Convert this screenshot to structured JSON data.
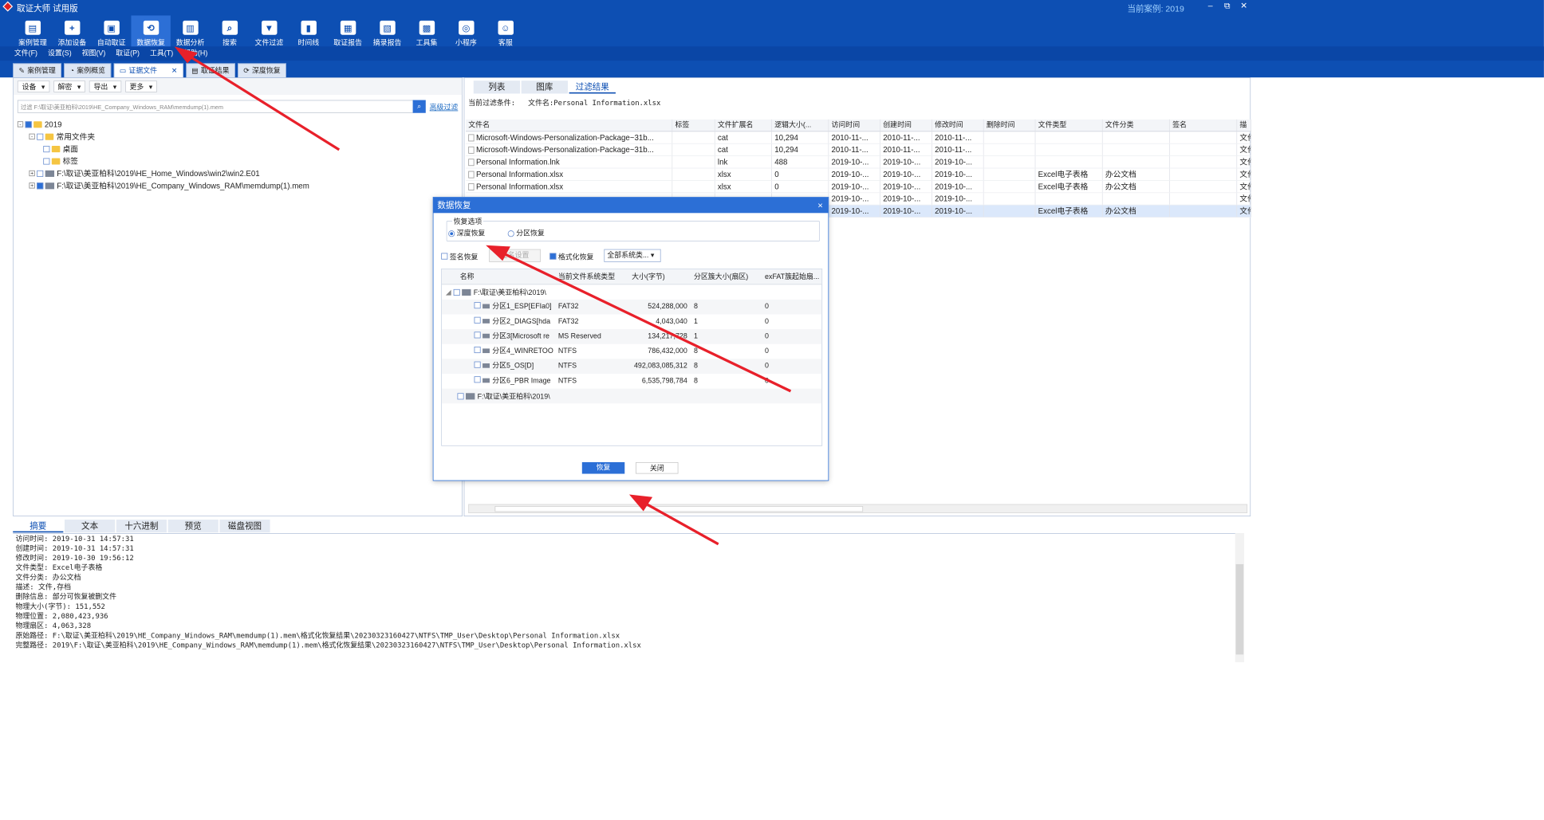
{
  "app": {
    "title": "取证大师 试用版",
    "current_case_label": "当前案例: 2019",
    "win_min": "–",
    "win_max": "⧉",
    "win_close": "✕"
  },
  "toolbar": [
    "案例管理",
    "添加设备",
    "自动取证",
    "数据恢复",
    "数据分析",
    "搜索",
    "文件过滤",
    "时间线",
    "取证报告",
    "摘录报告",
    "工具集",
    "小程序",
    "客服"
  ],
  "menu": [
    "文件(F)",
    "设置(S)",
    "视图(V)",
    "取证(P)",
    "工具(T)",
    "帮助(H)"
  ],
  "doc_tabs": [
    "案例管理",
    "案例概览",
    "证据文件",
    "取证结果",
    "深度恢复"
  ],
  "left": {
    "tools": [
      "设备",
      "解密",
      "导出",
      "更多"
    ],
    "filter_text": "过滤 F:\\取证\\美亚柏科\\2019\\HE_Company_Windows_RAM\\memdump(1).mem",
    "adv_filter": "高级过滤",
    "tree": [
      "2019",
      "常用文件夹",
      "桌面",
      "标签",
      "F:\\取证\\美亚柏科\\2019\\HE_Home_Windows\\win2\\win2.E01",
      "F:\\取证\\美亚柏科\\2019\\HE_Company_Windows_RAM\\memdump(1).mem"
    ]
  },
  "right": {
    "tabs": [
      "列表",
      "图库",
      "过滤结果"
    ],
    "cond_label": "当前过滤条件:",
    "cond_value": "文件名:Personal Information.xlsx",
    "columns": [
      "文件名",
      "标签",
      "文件扩展名",
      "逻辑大小(...",
      "访问时间",
      "创建时间",
      "修改时间",
      "删除时间",
      "文件类型",
      "文件分类",
      "签名",
      "描"
    ],
    "rows": [
      [
        "Microsoft-Windows-Personalization-Package~31b...",
        "",
        "cat",
        "10,294",
        "2010-11-...",
        "2010-11-...",
        "2010-11-...",
        "",
        "",
        "",
        "",
        "文件"
      ],
      [
        "Microsoft-Windows-Personalization-Package~31b...",
        "",
        "cat",
        "10,294",
        "2010-11-...",
        "2010-11-...",
        "2010-11-...",
        "",
        "",
        "",
        "",
        "文件"
      ],
      [
        "Personal Information.lnk",
        "",
        "lnk",
        "488",
        "2019-10-...",
        "2019-10-...",
        "2019-10-...",
        "",
        "",
        "",
        "",
        "文件"
      ],
      [
        "Personal Information.xlsx",
        "",
        "xlsx",
        "0",
        "2019-10-...",
        "2019-10-...",
        "2019-10-...",
        "",
        "Excel电子表格",
        "办公文档",
        "",
        "文件"
      ],
      [
        "Personal Information.xlsx",
        "",
        "xlsx",
        "0",
        "2019-10-...",
        "2019-10-...",
        "2019-10-...",
        "",
        "Excel电子表格",
        "办公文档",
        "",
        "文件"
      ],
      [
        "",
        "",
        "",
        "",
        "2019-10-...",
        "2019-10-...",
        "2019-10-...",
        "",
        "",
        "",
        "",
        "文件"
      ],
      [
        "",
        "",
        "",
        "",
        "2019-10-...",
        "2019-10-...",
        "2019-10-...",
        "",
        "Excel电子表格",
        "办公文档",
        "",
        "文件"
      ]
    ]
  },
  "bottom": {
    "tabs": [
      "摘要",
      "文本",
      "十六进制",
      "预览",
      "磁盘视图"
    ],
    "lines": [
      "访问时间: 2019-10-31 14:57:31",
      "创建时间: 2019-10-31 14:57:31",
      "修改时间: 2019-10-30 19:56:12",
      "文件类型: Excel电子表格",
      "文件分类: 办公文档",
      "描述: 文件,存档",
      "删除信息: 部分可恢复被删文件",
      "物理大小(字节): 151,552",
      "物理位置: 2,080,423,936",
      "物理扇区: 4,063,328",
      "原始路径: F:\\取证\\美亚柏科\\2019\\HE_Company_Windows_RAM\\memdump(1).mem\\格式化恢复结果\\20230323160427\\NTFS\\TMP_User\\Desktop\\Personal Information.xlsx",
      "完整路径: 2019\\F:\\取证\\美亚柏科\\2019\\HE_Company_Windows_RAM\\memdump(1).mem\\格式化恢复结果\\20230323160427\\NTFS\\TMP_User\\Desktop\\Personal Information.xlsx"
    ]
  },
  "dialog": {
    "title": "数据恢复",
    "close": "×",
    "group": "恢复选项",
    "deep": "深度恢复",
    "partition": "分区恢复",
    "sig": "签名恢复",
    "sig_settings": "签名设置",
    "fmt": "格式化恢复",
    "fs_select": "全部系统类...",
    "cols": [
      "名称",
      "当前文件系统类型",
      "大小(字节)",
      "分区簇大小(扇区)",
      "exFAT簇起始扇..."
    ],
    "root1": "F:\\取证\\美亚柏科\\2019\\",
    "root2": "F:\\取证\\美亚柏科\\2019\\",
    "parts": [
      [
        "分区1_ESP[EFIa0]",
        "FAT32",
        "524,288,000",
        "8",
        "0"
      ],
      [
        "分区2_DIAGS[hda",
        "FAT32",
        "4,043,040",
        "1",
        "0"
      ],
      [
        "分区3[Microsoft re",
        "MS Reserved",
        "134,217,728",
        "1",
        "0"
      ],
      [
        "分区4_WINRETOO",
        "NTFS",
        "786,432,000",
        "8",
        "0"
      ],
      [
        "分区5_OS[D]",
        "NTFS",
        "492,083,085,312",
        "8",
        "0"
      ],
      [
        "分区6_PBR Image",
        "NTFS",
        "6,535,798,784",
        "8",
        "0"
      ]
    ],
    "ok": "恢复",
    "cancel": "关闭"
  },
  "colors": {
    "brand": "#0d4fb3",
    "accent": "#2c6fd6",
    "arrow": "#e8202a"
  }
}
